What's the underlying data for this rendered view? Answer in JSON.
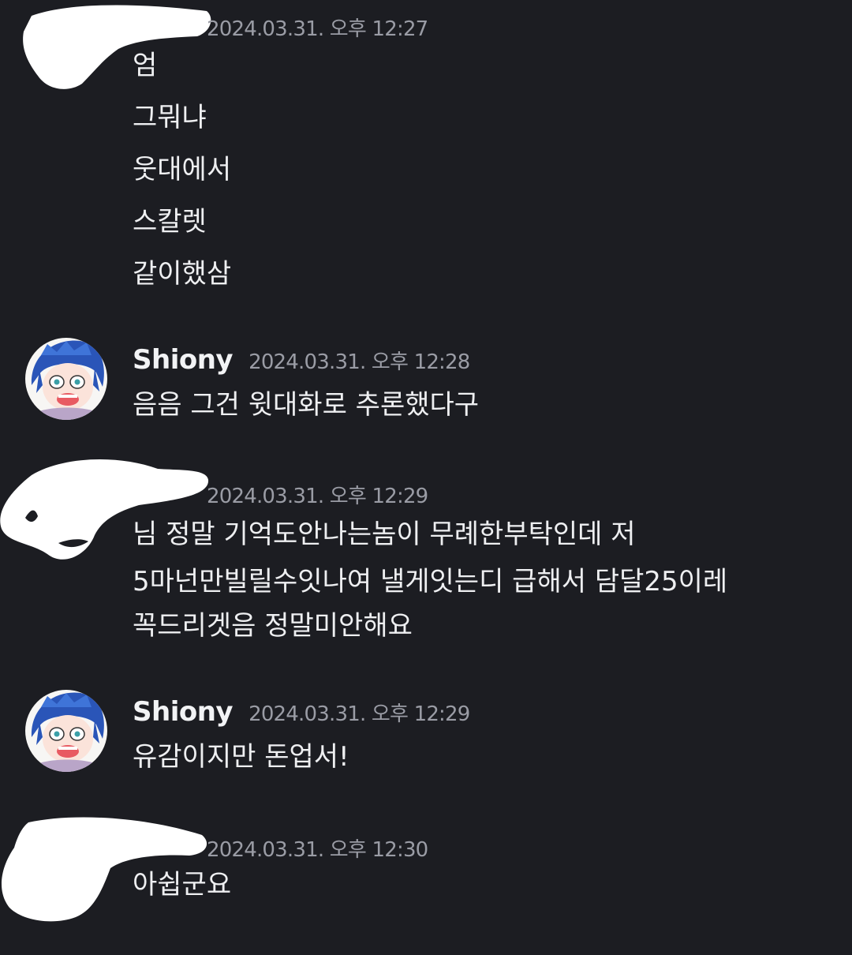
{
  "messages": [
    {
      "author": "",
      "timestamp": "2024.03.31. 오후 12:27",
      "lines": [
        "엄",
        "그뭐냐",
        "웃대에서",
        "스칼렛",
        "같이했삼"
      ]
    },
    {
      "author": "Shiony",
      "timestamp": "2024.03.31. 오후 12:28",
      "lines": [
        "음음 그건 윗대화로 추론했다구"
      ]
    },
    {
      "author": "",
      "timestamp": "2024.03.31. 오후 12:29",
      "lines": [
        "님 정말 기억도안나는놈이 무례한부탁인데 저",
        "5마넌만빌릴수잇나여 낼게잇는디 급해서 담달25이레",
        "꼭드리겟음 정말미안해요"
      ]
    },
    {
      "author": "Shiony",
      "timestamp": "2024.03.31. 오후 12:29",
      "lines": [
        "유감이지만 돈업서!"
      ]
    },
    {
      "author": "",
      "timestamp": "2024.03.31. 오후 12:30",
      "lines": [
        "아쉽군요"
      ]
    }
  ],
  "colors": {
    "background": "#1c1d22",
    "username": "#f2f3f5",
    "timestamp": "#9a9ca5",
    "message_text": "#eeeff1",
    "redaction": "#ffffff"
  },
  "icons": {
    "shiony_avatar": "anime-character-crying-avatar",
    "redacted_avatar": "redacted-scribble"
  }
}
